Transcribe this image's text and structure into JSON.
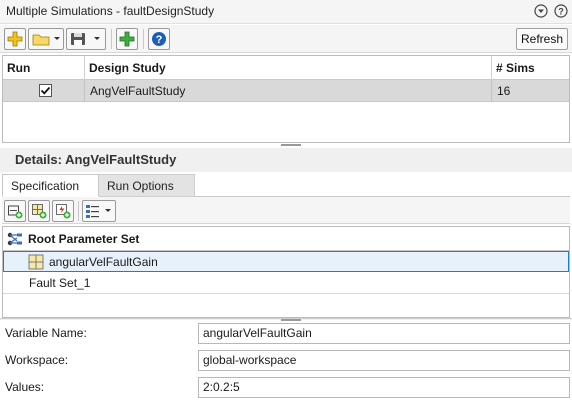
{
  "window": {
    "title": "Multiple Simulations - faultDesignStudy"
  },
  "toolbar": {
    "refresh_label": "Refresh"
  },
  "grid": {
    "columns": [
      "Run",
      "Design Study",
      "# Sims"
    ],
    "rows": [
      {
        "run_checked": true,
        "design_study": "AngVelFaultStudy",
        "sims": "16"
      }
    ]
  },
  "details": {
    "title": "Details: AngVelFaultStudy",
    "tabs": [
      "Specification",
      "Run Options"
    ]
  },
  "tree": {
    "root_label": "Root Parameter Set",
    "items": [
      {
        "label": "angularVelFaultGain",
        "selected": true
      },
      {
        "label": "Fault Set_1",
        "selected": false
      }
    ]
  },
  "form": {
    "variable_name_label": "Variable Name:",
    "variable_name_value": "angularVelFaultGain",
    "workspace_label": "Workspace:",
    "workspace_value": "global-workspace",
    "values_label": "Values:",
    "values_value": "2:0.2:5"
  },
  "colors": {
    "accent_yellow": "#f3c31b",
    "accent_green": "#2f9e2f",
    "selection_border": "#1a7fd1",
    "help_blue": "#1d5fb8"
  },
  "icons": [
    "collapse-icon",
    "help-circle-icon",
    "new-icon",
    "open-folder-icon",
    "save-icon",
    "add-icon",
    "help-icon",
    "add-parameter-icon",
    "add-parameter-space-icon",
    "add-fault-icon",
    "view-options-icon",
    "tree-root-icon",
    "parameter-grid-icon",
    "check-icon"
  ]
}
